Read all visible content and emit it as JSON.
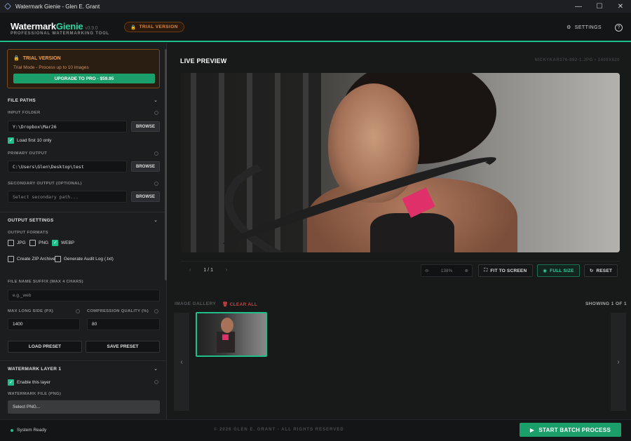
{
  "window": {
    "title": "Watermark Gienie - Glen E. Grant"
  },
  "header": {
    "logo_main": "Watermark",
    "logo_accent": "Gienie",
    "version": "v3.9.0",
    "tagline": "PROFESSIONAL WATERMARKING TOOL",
    "trial_badge": "TRIAL VERSION",
    "settings_label": "SETTINGS"
  },
  "trial_box": {
    "title": "TRIAL VERSION",
    "message": "Trial Mode - Process up to 10 images",
    "upgrade_label": "UPGRADE TO PRO - $59.95"
  },
  "file_paths": {
    "section_title": "FILE PATHS",
    "input_label": "INPUT FOLDER",
    "input_value": "Y:\\Dropbox\\Mar26",
    "load_first_label": "Load first 10 only",
    "load_first_checked": true,
    "primary_label": "PRIMARY OUTPUT",
    "primary_value": "C:\\Users\\Glen\\Desktop\\test",
    "secondary_label": "SECONDARY OUTPUT (OPTIONAL)",
    "secondary_placeholder": "Select secondary path...",
    "browse_label": "BROWSE"
  },
  "output_settings": {
    "section_title": "OUTPUT SETTINGS",
    "formats_label": "OUTPUT FORMATS",
    "formats": [
      {
        "label": "JPG",
        "checked": false
      },
      {
        "label": "PNG",
        "checked": false
      },
      {
        "label": "WEBP",
        "checked": true
      }
    ],
    "zip_label": "Create ZIP Archive",
    "audit_label": "Generate Audit Log (.txt)",
    "suffix_label": "FILE NAME SUFFIX (MAX 4 CHARS)",
    "suffix_placeholder": "e.g._web",
    "max_long_label": "MAX LONG SIDE (PX)",
    "max_long_value": "1400",
    "quality_label": "COMPRESSION QUALITY (%)",
    "quality_value": "80",
    "load_preset": "LOAD PRESET",
    "save_preset": "SAVE PRESET"
  },
  "watermark_layer": {
    "section_title": "WATERMARK LAYER 1",
    "enable_label": "Enable this layer",
    "enable_checked": true,
    "file_label": "WATERMARK FILE (PNG)",
    "file_value": "Select PNG..."
  },
  "preview": {
    "title": "LIVE PREVIEW",
    "file_info": "NICKYKAR376-892-1.JPG • 1400X820",
    "page": "1 / 1",
    "zoom": "138%",
    "fit_label": "FIT TO SCREEN",
    "full_label": "FULL SIZE",
    "reset_label": "RESET"
  },
  "gallery": {
    "title": "IMAGE GALLERY",
    "clear_label": "CLEAR ALL",
    "showing": "SHOWING 1 OF 1"
  },
  "footer": {
    "status": "System Ready",
    "copyright": "© 2026 GLEN E. GRANT - ALL RIGHTS RESERVED",
    "start_label": "START BATCH PROCESS"
  },
  "colors": {
    "accent": "#1fbf8a",
    "trial": "#e0883a",
    "danger": "#d04040"
  }
}
